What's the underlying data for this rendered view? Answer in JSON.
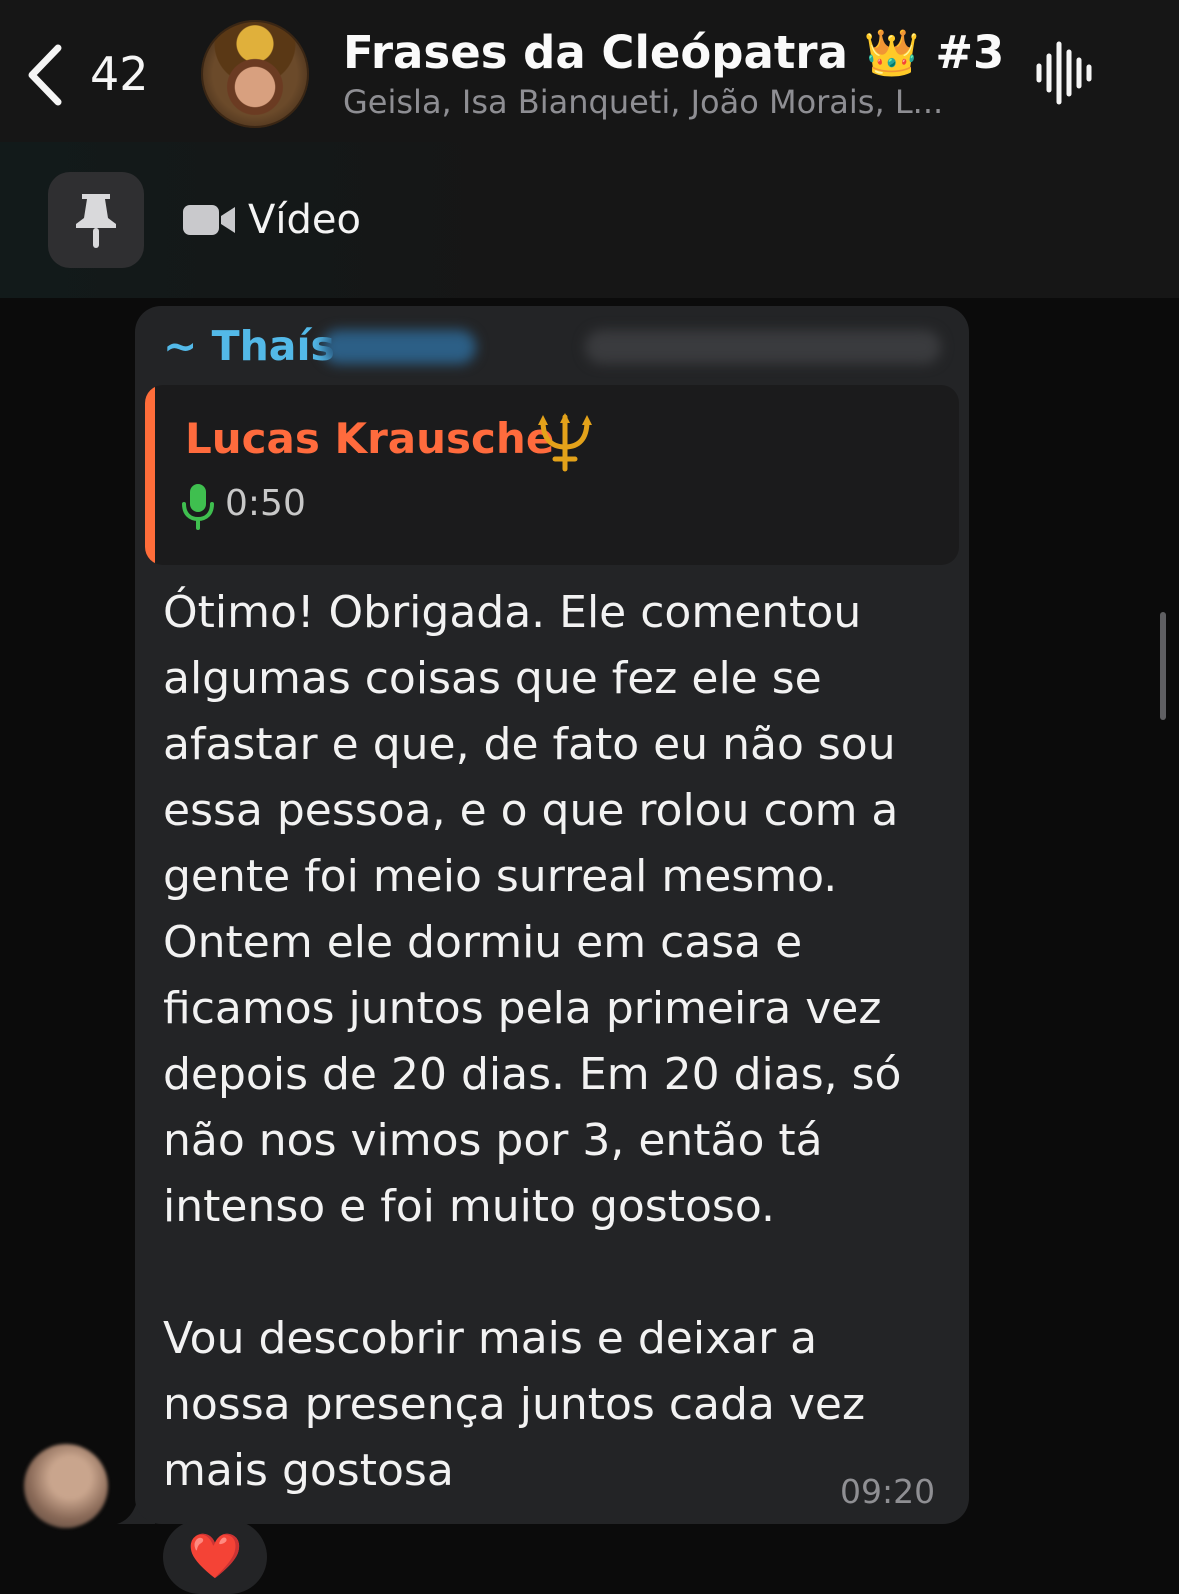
{
  "header": {
    "unread_count": "42",
    "title": "Frases da Cleópatra 👑 #3",
    "subtitle": "Geisla, Isa Bianqueti, João Morais, L...",
    "back_icon": "chevron-left-icon",
    "voice_icon": "waveform-icon"
  },
  "pinned": {
    "icon": "pin-icon",
    "media_icon": "video-camera-icon",
    "label": "Vídeo"
  },
  "message": {
    "sender": "~ Thaís",
    "reply": {
      "author": "Lucas Krausche",
      "author_emoji": "trident-icon",
      "duration": "0:50"
    },
    "text": "Ótimo! Obrigada. Ele comentou\nalgumas coisas que fez ele se\nafastar e que, de fato eu não sou\nessa pessoa, e o que rolou com a\ngente foi meio surreal mesmo.\nOntem ele dormiu em casa e\nficamos juntos pela primeira vez\ndepois de 20 dias. Em 20 dias, só\nnão nos vimos por 3, então tá\nintenso e foi muito gostoso.\n\nVou descobrir mais e deixar a\nnossa presença juntos cada vez\nmais gostosa",
    "time": "09:20",
    "reaction": "❤️"
  },
  "colors": {
    "sender_name": "#53b9e8",
    "reply_author": "#ff6b3d",
    "reply_accent": "#ff6d3a",
    "mic": "#3fbf4f",
    "bubble": "#232426",
    "background": "#0b0b0b"
  }
}
